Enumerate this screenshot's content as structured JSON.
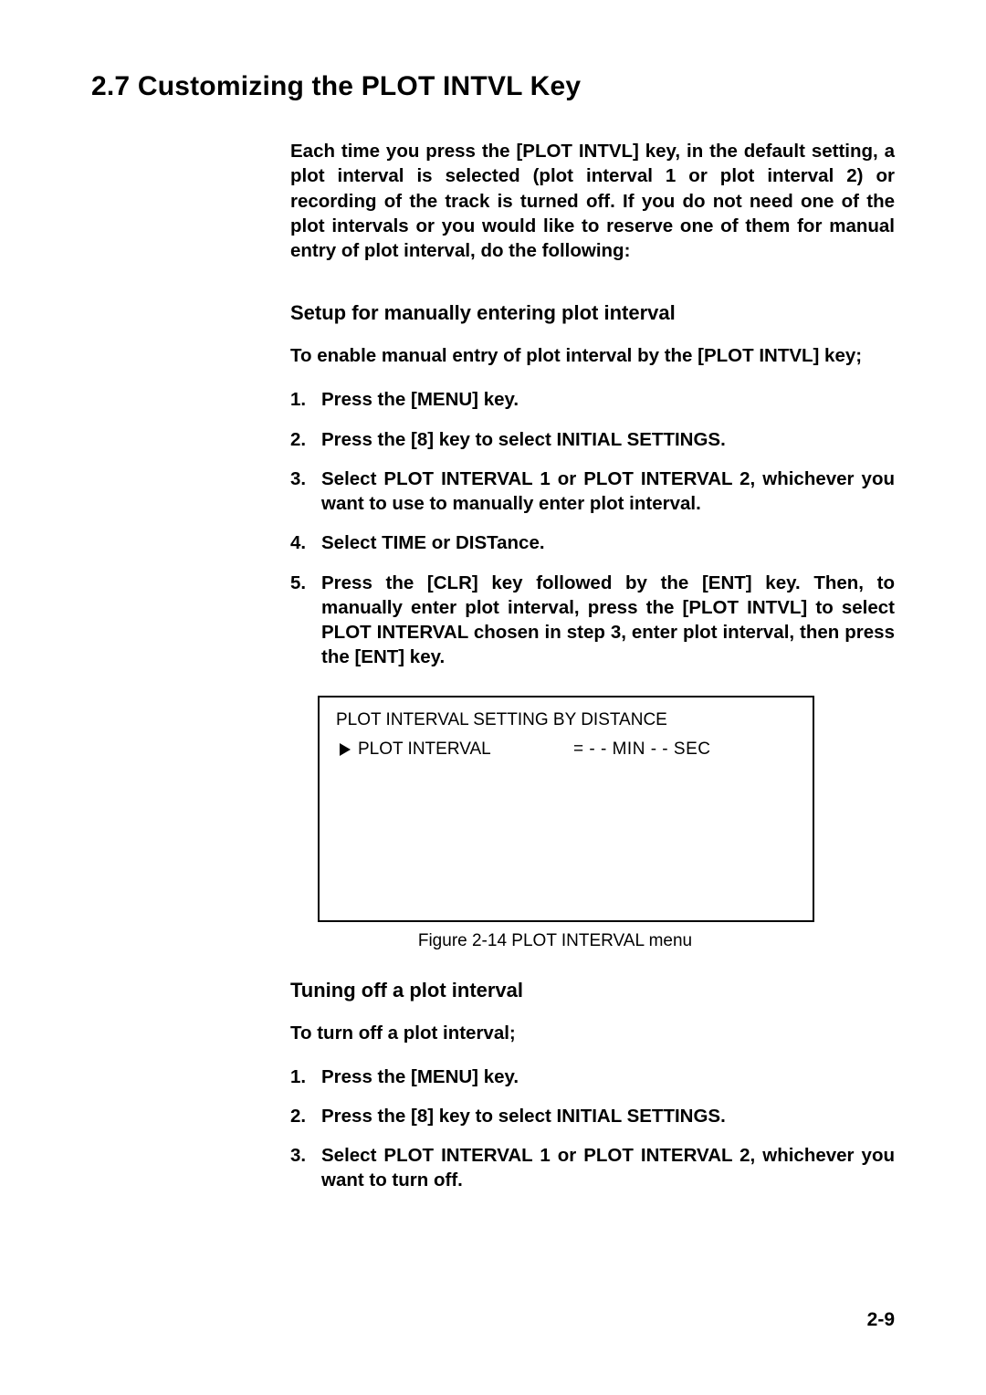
{
  "heading": "2.7 Customizing the PLOT INTVL Key",
  "intro": "Each time you press the [PLOT INTVL] key, in the default setting, a plot interval is selected (plot interval 1 or plot interval 2) or recording of the track is turned off. If you do not need one of the plot intervals or you would like to reserve one of them for manual entry of plot interval, do the following:",
  "section1": {
    "title": "Setup for manually entering plot interval",
    "lead": "To enable manual entry of plot interval by the [PLOT INTVL] key;",
    "steps": [
      "Press the [MENU] key.",
      "Press the [8] key to select INITIAL SETTINGS.",
      "Select PLOT INTERVAL 1 or PLOT INTERVAL 2, whichever you want to use to manually enter plot interval.",
      "Select TIME or DISTance.",
      "Press the [CLR] key followed by the [ENT] key. Then, to manually enter plot interval, press the [PLOT INTVL] to select PLOT INTERVAL chosen in step 3, enter plot interval, then press the [ENT] key."
    ]
  },
  "figure": {
    "title": "PLOT INTERVAL SETTING BY DISTANCE",
    "row_label": "PLOT INTERVAL",
    "row_value": "=  - -  MIN - -  SEC",
    "caption": "Figure 2-14 PLOT INTERVAL menu"
  },
  "section2": {
    "title": "Tuning off a plot interval",
    "lead": "To turn off a plot interval;",
    "steps": [
      "Press the [MENU] key.",
      "Press the [8] key to select INITIAL SETTINGS.",
      "Select PLOT INTERVAL 1 or PLOT INTERVAL 2, whichever you want to turn off."
    ]
  },
  "page_number": "2-9"
}
